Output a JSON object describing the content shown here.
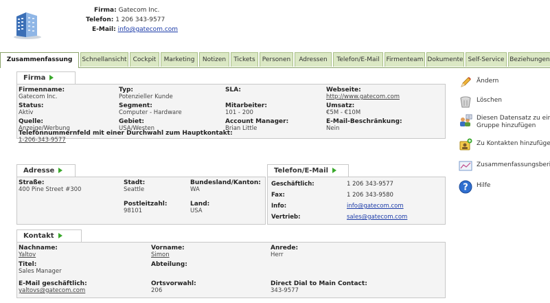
{
  "header": {
    "firma_label": "Firma:",
    "firma_value": "Gatecom Inc.",
    "telefon_label": "Telefon:",
    "telefon_value": "1 206 343-9577",
    "email_label": "E-Mail:",
    "email_value": "info@gatecom.com",
    "logo_icon": "building-icon"
  },
  "tabs": [
    "Zusammenfassung",
    "Schnellansicht",
    "Cockpit",
    "Marketing",
    "Notizen",
    "Tickets",
    "Personen",
    "Adressen",
    "Telefon/E-Mail",
    "Firmenteam",
    "Dokumente",
    "Self-Service",
    "Beziehungen"
  ],
  "firma": {
    "title": "Firma",
    "firmenname_label": "Firmenname:",
    "firmenname": "Gatecom Inc.",
    "typ_label": "Typ:",
    "typ": "Potenzieller Kunde",
    "sla_label": "SLA:",
    "sla": "",
    "webseite_label": "Webseite:",
    "webseite": "http://www.gatecom.com",
    "status_label": "Status:",
    "status": "Aktiv",
    "segment_label": "Segment:",
    "segment": "Computer - Hardware",
    "mitarbeiter_label": "Mitarbeiter:",
    "mitarbeiter": "101 - 200",
    "umsatz_label": "Umsatz:",
    "umsatz": "€5M - €10M",
    "quelle_label": "Quelle:",
    "quelle": "Anzeige/Werbung",
    "gebiet_label": "Gebiet:",
    "gebiet": "USA/Westen",
    "account_label": "Account Manager:",
    "account": "Brian Little",
    "emailb_label": "E-Mail-Beschränkung:",
    "emailb": "Nein",
    "tel_label": "Telefonnummernfeld mit einer Durchwahl zum Hauptkontakt:",
    "tel": "1-206-343-9577"
  },
  "adresse": {
    "title": "Adresse",
    "strasse_label": "Straße:",
    "strasse": "400 Pine Street #300",
    "stadt_label": "Stadt:",
    "stadt": "Seattle",
    "bundesland_label": "Bundesland/Kanton:",
    "bundesland": "WA",
    "plz_label": "Postleitzahl:",
    "plz": "98101",
    "land_label": "Land:",
    "land": "USA"
  },
  "telefon": {
    "title": "Telefon/E-Mail",
    "gesch_label": "Geschäftlich:",
    "gesch": "1 206 343-9577",
    "fax_label": "Fax:",
    "fax": "1 206 343-9580",
    "info_label": "Info:",
    "info": "info@gatecom.com",
    "vertrieb_label": "Vertrieb:",
    "vertrieb": "sales@gatecom.com"
  },
  "kontakt": {
    "title": "Kontakt",
    "nachname_label": "Nachname:",
    "nachname": "Yaltov",
    "vorname_label": "Vorname:",
    "vorname": "Simon",
    "anrede_label": "Anrede:",
    "anrede": "Herr",
    "titel_label": "Titel:",
    "titel": "Sales Manager",
    "abteilung_label": "Abteilung:",
    "abteilung": "",
    "email_label": "E-Mail geschäftlich:",
    "email": "yaltovs@gatecom.com",
    "ortsvorwahl_label": "Ortsvorwahl:",
    "ortsvorwahl": "206",
    "direct_label": "Direct Dial to Main Contact:",
    "direct": "343-9577"
  },
  "sidebar": {
    "aendern": "Ändern",
    "loeschen": "Löschen",
    "gruppe_line1": "Diesen Datensatz zu einer",
    "gruppe_line2": "Gruppe hinzufügen",
    "kontakte": "Zu Kontakten hinzufügen",
    "bericht": "Zusammenfassungsbericht",
    "hilfe": "Hilfe"
  }
}
